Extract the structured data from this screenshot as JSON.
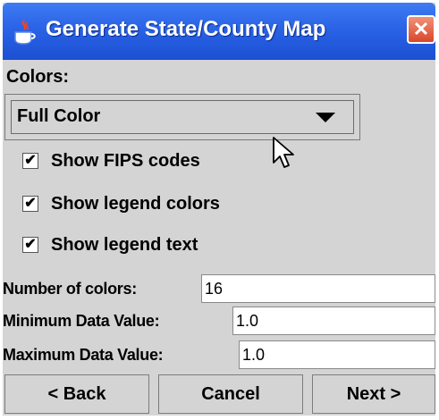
{
  "window": {
    "title": "Generate State/County Map",
    "close_label": "✕"
  },
  "colors": {
    "label": "Colors:",
    "selected": "Full Color"
  },
  "options": [
    {
      "label": "Show FIPS codes",
      "checked": true
    },
    {
      "label": "Show legend colors",
      "checked": true
    },
    {
      "label": "Show legend text",
      "checked": true
    }
  ],
  "fields": {
    "num_colors": {
      "label": "Number of colors:",
      "value": "16"
    },
    "min_value": {
      "label": "Minimum Data Value:",
      "value": "1.0"
    },
    "max_value": {
      "label": "Maximum Data Value:",
      "value": "1.0"
    }
  },
  "buttons": {
    "back": "< Back",
    "cancel": "Cancel",
    "next": "Next >"
  },
  "check_mark": "✔",
  "icons": {
    "title": "java-coffee-cup-icon",
    "close": "close-icon",
    "dropdown": "chevron-down-icon",
    "cursor": "mouse-pointer-icon"
  },
  "colors_theme": {
    "titlebar": "#2a63e6",
    "close": "#d9462a",
    "window_bg": "#d4d4d4"
  }
}
